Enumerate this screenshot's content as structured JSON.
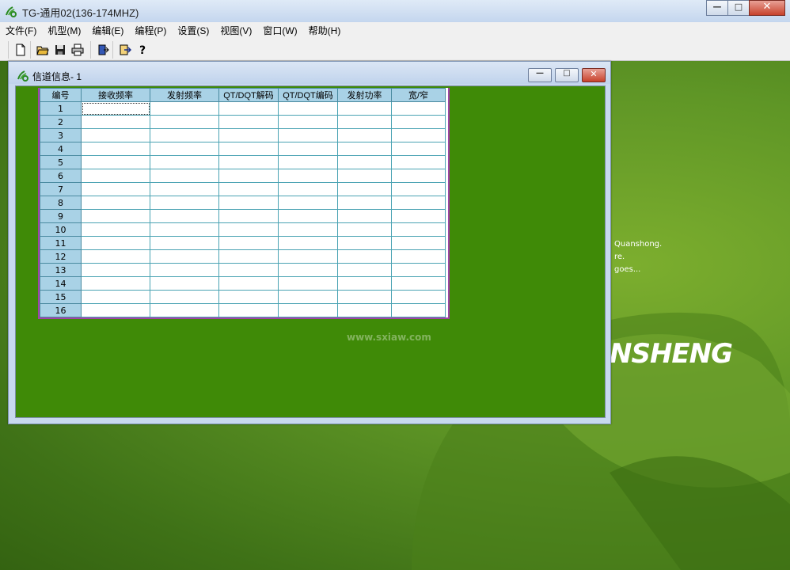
{
  "app": {
    "title": "TG-通用02(136-174MHZ)",
    "window_buttons": {
      "minimize": "—",
      "maximize": "□",
      "close": "✕"
    }
  },
  "menu": {
    "items": [
      "文件(F)",
      "机型(M)",
      "编辑(E)",
      "编程(P)",
      "设置(S)",
      "视图(V)",
      "窗口(W)",
      "帮助(H)"
    ]
  },
  "toolbar": {
    "icons": [
      "new-icon",
      "open-icon",
      "save-icon",
      "print-icon",
      "read-radio-icon",
      "write-radio-icon",
      "help-icon"
    ]
  },
  "background": {
    "lines": [
      "Quanshong.",
      "re.",
      "goes..."
    ],
    "brand": "NSHENG",
    "colors": {
      "primary": "#3f8a07",
      "light": "#7cae2e"
    }
  },
  "channel_window": {
    "title": "信道信息- 1",
    "buttons": {
      "minimize": "—",
      "maximize": "□",
      "close": "✕"
    },
    "columns": [
      "编号",
      "接收频率",
      "发射频率",
      "QT/DQT解码",
      "QT/DQT编码",
      "发射功率",
      "宽/窄"
    ],
    "row_numbers": [
      "1",
      "2",
      "3",
      "4",
      "5",
      "6",
      "7",
      "8",
      "9",
      "10",
      "11",
      "12",
      "13",
      "14",
      "15",
      "16"
    ]
  },
  "watermark": {
    "text": "www.sxiaw.com"
  }
}
